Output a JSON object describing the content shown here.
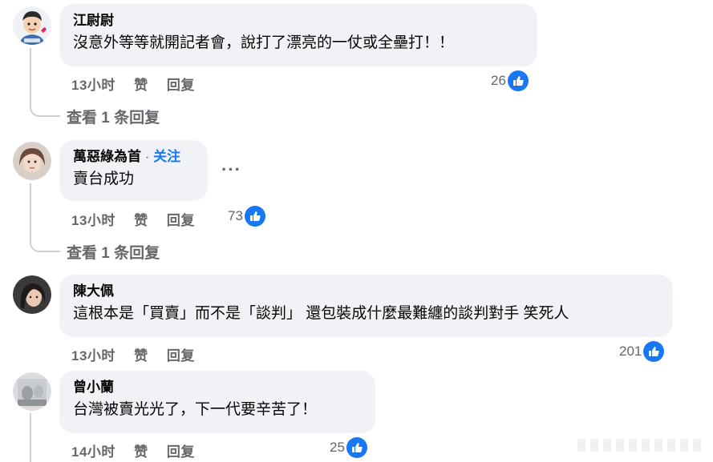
{
  "comments": [
    {
      "author": "江尉尉",
      "text": "沒意外等等就開記者會，說打了漂亮的一仗或全壘打！！",
      "time": "13小时",
      "like_label": "赞",
      "reply_label": "回复",
      "reactions": "26",
      "view_replies": "查看 1 条回复"
    },
    {
      "author": "萬惡綠為首",
      "follow_sep": "·",
      "follow_label": "关注",
      "text": "賣台成功",
      "time": "13小时",
      "like_label": "赞",
      "reply_label": "回复",
      "reactions": "73",
      "view_replies": "查看 1 条回复",
      "more_label": "···"
    },
    {
      "author": "陳大佩",
      "text": "這根本是「買賣」而不是「談判」 還包裝成什麼最難纏的談判對手 笑死人",
      "time": "13小时",
      "like_label": "赞",
      "reply_label": "回复",
      "reactions": "201"
    },
    {
      "author": "曾小蘭",
      "text": "台灣被賣光光了，下一代要辛苦了！",
      "time": "14小时",
      "like_label": "赞",
      "reply_label": "回复",
      "reactions": "25"
    }
  ],
  "colors": {
    "bubble": "#f0f2f5",
    "meta": "#65676b",
    "like_blue": "#1877f2",
    "thread_line": "#ccd0d5"
  },
  "icons": [
    "avatar",
    "thumbs-up-icon",
    "more-options-icon"
  ]
}
